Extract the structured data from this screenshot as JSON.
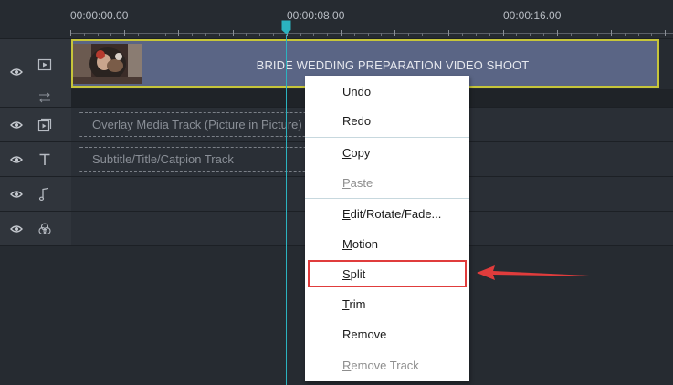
{
  "ruler": {
    "t0": "00:00:00.00",
    "t1": "00:00:08.00",
    "t2": "00:00:16.00"
  },
  "tracks": {
    "video_clip_title": "BRIDE WEDDING PREPARATION VIDEO SHOOT",
    "overlay_placeholder": "Overlay Media Track (Picture in Picture)",
    "subtitle_placeholder": "Subtitle/Title/Catpion Track"
  },
  "menu": {
    "undo": "Undo",
    "redo": "Redo",
    "copy_key": "C",
    "copy_rest": "opy",
    "paste_key": "P",
    "paste_rest": "aste",
    "edit_key": "E",
    "edit_rest": "dit/Rotate/Fade...",
    "motion_key": "M",
    "motion_rest": "otion",
    "split_key": "S",
    "split_rest": "plit",
    "trim_key": "T",
    "trim_rest": "rim",
    "remove": "Remove",
    "remove_track_key": "R",
    "remove_track_rest": "emove Track"
  },
  "colors": {
    "accent_playhead": "#2bb3c0",
    "clip_border": "#c6c53a",
    "highlight": "#e03c3c"
  }
}
